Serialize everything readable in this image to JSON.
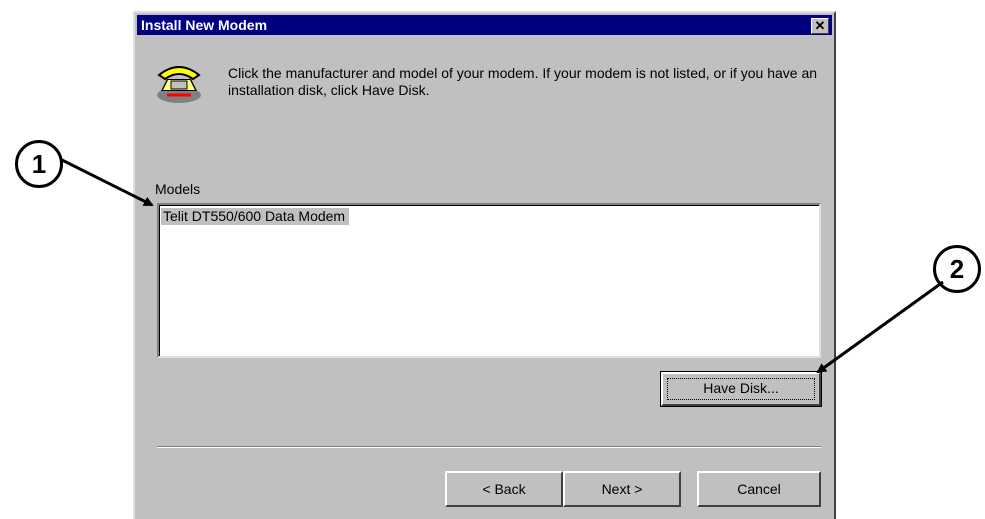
{
  "dialog": {
    "title": "Install New Modem",
    "close_label": "✕",
    "instructions": "Click the manufacturer and model of your modem. If your modem is not listed, or if you have an installation disk, click Have Disk.",
    "models_label": "Models",
    "models": [
      "Telit DT550/600 Data Modem"
    ],
    "have_disk_label": "Have Disk...",
    "back_label": "< Back",
    "next_label": "Next >",
    "cancel_label": "Cancel"
  },
  "callouts": [
    "1",
    "2"
  ],
  "colors": {
    "titlebar": "#000080",
    "dialog_bg": "#c0c0c0",
    "list_bg": "#ffffff"
  }
}
